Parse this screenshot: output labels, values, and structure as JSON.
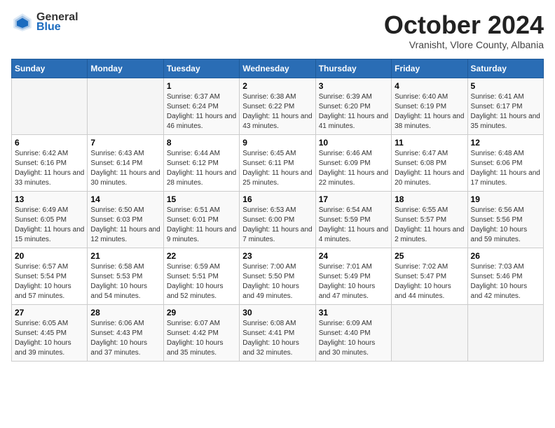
{
  "header": {
    "logo_general": "General",
    "logo_blue": "Blue",
    "month_title": "October 2024",
    "subtitle": "Vranisht, Vlore County, Albania"
  },
  "days_of_week": [
    "Sunday",
    "Monday",
    "Tuesday",
    "Wednesday",
    "Thursday",
    "Friday",
    "Saturday"
  ],
  "weeks": [
    [
      {
        "num": "",
        "sunrise": "",
        "sunset": "",
        "daylight": ""
      },
      {
        "num": "",
        "sunrise": "",
        "sunset": "",
        "daylight": ""
      },
      {
        "num": "1",
        "sunrise": "Sunrise: 6:37 AM",
        "sunset": "Sunset: 6:24 PM",
        "daylight": "Daylight: 11 hours and 46 minutes."
      },
      {
        "num": "2",
        "sunrise": "Sunrise: 6:38 AM",
        "sunset": "Sunset: 6:22 PM",
        "daylight": "Daylight: 11 hours and 43 minutes."
      },
      {
        "num": "3",
        "sunrise": "Sunrise: 6:39 AM",
        "sunset": "Sunset: 6:20 PM",
        "daylight": "Daylight: 11 hours and 41 minutes."
      },
      {
        "num": "4",
        "sunrise": "Sunrise: 6:40 AM",
        "sunset": "Sunset: 6:19 PM",
        "daylight": "Daylight: 11 hours and 38 minutes."
      },
      {
        "num": "5",
        "sunrise": "Sunrise: 6:41 AM",
        "sunset": "Sunset: 6:17 PM",
        "daylight": "Daylight: 11 hours and 35 minutes."
      }
    ],
    [
      {
        "num": "6",
        "sunrise": "Sunrise: 6:42 AM",
        "sunset": "Sunset: 6:16 PM",
        "daylight": "Daylight: 11 hours and 33 minutes."
      },
      {
        "num": "7",
        "sunrise": "Sunrise: 6:43 AM",
        "sunset": "Sunset: 6:14 PM",
        "daylight": "Daylight: 11 hours and 30 minutes."
      },
      {
        "num": "8",
        "sunrise": "Sunrise: 6:44 AM",
        "sunset": "Sunset: 6:12 PM",
        "daylight": "Daylight: 11 hours and 28 minutes."
      },
      {
        "num": "9",
        "sunrise": "Sunrise: 6:45 AM",
        "sunset": "Sunset: 6:11 PM",
        "daylight": "Daylight: 11 hours and 25 minutes."
      },
      {
        "num": "10",
        "sunrise": "Sunrise: 6:46 AM",
        "sunset": "Sunset: 6:09 PM",
        "daylight": "Daylight: 11 hours and 22 minutes."
      },
      {
        "num": "11",
        "sunrise": "Sunrise: 6:47 AM",
        "sunset": "Sunset: 6:08 PM",
        "daylight": "Daylight: 11 hours and 20 minutes."
      },
      {
        "num": "12",
        "sunrise": "Sunrise: 6:48 AM",
        "sunset": "Sunset: 6:06 PM",
        "daylight": "Daylight: 11 hours and 17 minutes."
      }
    ],
    [
      {
        "num": "13",
        "sunrise": "Sunrise: 6:49 AM",
        "sunset": "Sunset: 6:05 PM",
        "daylight": "Daylight: 11 hours and 15 minutes."
      },
      {
        "num": "14",
        "sunrise": "Sunrise: 6:50 AM",
        "sunset": "Sunset: 6:03 PM",
        "daylight": "Daylight: 11 hours and 12 minutes."
      },
      {
        "num": "15",
        "sunrise": "Sunrise: 6:51 AM",
        "sunset": "Sunset: 6:01 PM",
        "daylight": "Daylight: 11 hours and 9 minutes."
      },
      {
        "num": "16",
        "sunrise": "Sunrise: 6:53 AM",
        "sunset": "Sunset: 6:00 PM",
        "daylight": "Daylight: 11 hours and 7 minutes."
      },
      {
        "num": "17",
        "sunrise": "Sunrise: 6:54 AM",
        "sunset": "Sunset: 5:59 PM",
        "daylight": "Daylight: 11 hours and 4 minutes."
      },
      {
        "num": "18",
        "sunrise": "Sunrise: 6:55 AM",
        "sunset": "Sunset: 5:57 PM",
        "daylight": "Daylight: 11 hours and 2 minutes."
      },
      {
        "num": "19",
        "sunrise": "Sunrise: 6:56 AM",
        "sunset": "Sunset: 5:56 PM",
        "daylight": "Daylight: 10 hours and 59 minutes."
      }
    ],
    [
      {
        "num": "20",
        "sunrise": "Sunrise: 6:57 AM",
        "sunset": "Sunset: 5:54 PM",
        "daylight": "Daylight: 10 hours and 57 minutes."
      },
      {
        "num": "21",
        "sunrise": "Sunrise: 6:58 AM",
        "sunset": "Sunset: 5:53 PM",
        "daylight": "Daylight: 10 hours and 54 minutes."
      },
      {
        "num": "22",
        "sunrise": "Sunrise: 6:59 AM",
        "sunset": "Sunset: 5:51 PM",
        "daylight": "Daylight: 10 hours and 52 minutes."
      },
      {
        "num": "23",
        "sunrise": "Sunrise: 7:00 AM",
        "sunset": "Sunset: 5:50 PM",
        "daylight": "Daylight: 10 hours and 49 minutes."
      },
      {
        "num": "24",
        "sunrise": "Sunrise: 7:01 AM",
        "sunset": "Sunset: 5:49 PM",
        "daylight": "Daylight: 10 hours and 47 minutes."
      },
      {
        "num": "25",
        "sunrise": "Sunrise: 7:02 AM",
        "sunset": "Sunset: 5:47 PM",
        "daylight": "Daylight: 10 hours and 44 minutes."
      },
      {
        "num": "26",
        "sunrise": "Sunrise: 7:03 AM",
        "sunset": "Sunset: 5:46 PM",
        "daylight": "Daylight: 10 hours and 42 minutes."
      }
    ],
    [
      {
        "num": "27",
        "sunrise": "Sunrise: 6:05 AM",
        "sunset": "Sunset: 4:45 PM",
        "daylight": "Daylight: 10 hours and 39 minutes."
      },
      {
        "num": "28",
        "sunrise": "Sunrise: 6:06 AM",
        "sunset": "Sunset: 4:43 PM",
        "daylight": "Daylight: 10 hours and 37 minutes."
      },
      {
        "num": "29",
        "sunrise": "Sunrise: 6:07 AM",
        "sunset": "Sunset: 4:42 PM",
        "daylight": "Daylight: 10 hours and 35 minutes."
      },
      {
        "num": "30",
        "sunrise": "Sunrise: 6:08 AM",
        "sunset": "Sunset: 4:41 PM",
        "daylight": "Daylight: 10 hours and 32 minutes."
      },
      {
        "num": "31",
        "sunrise": "Sunrise: 6:09 AM",
        "sunset": "Sunset: 4:40 PM",
        "daylight": "Daylight: 10 hours and 30 minutes."
      },
      {
        "num": "",
        "sunrise": "",
        "sunset": "",
        "daylight": ""
      },
      {
        "num": "",
        "sunrise": "",
        "sunset": "",
        "daylight": ""
      }
    ]
  ]
}
